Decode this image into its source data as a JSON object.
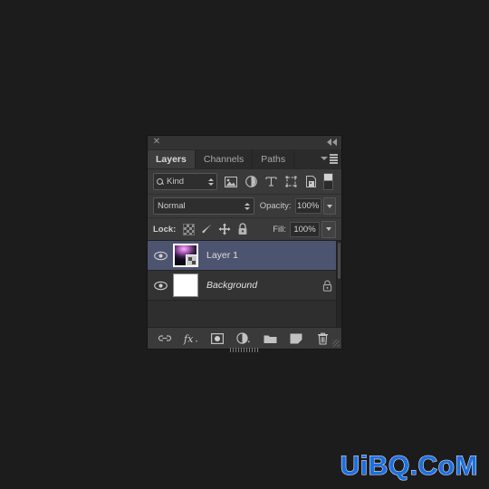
{
  "app": {
    "background_color": "#1d1c1c",
    "accent_selected_row": "#4d5470",
    "panel_background": "#3a3a3a"
  },
  "panel": {
    "titlebar": {
      "close_label": "✕",
      "close_icon": "close-icon",
      "collapse_icon": "collapse-double-chevron-icon"
    },
    "tabs": [
      {
        "label": "Layers",
        "active": true
      },
      {
        "label": "Channels",
        "active": false
      },
      {
        "label": "Paths",
        "active": false
      }
    ],
    "menu_icon": "panel-menu-icon",
    "filter_row": {
      "kind_label": "Kind",
      "search_icon": "search-icon",
      "stepper_icon": "up-down-stepper-icon",
      "filters": [
        {
          "name": "filter-pixel-layers-icon",
          "title": "Pixel layers"
        },
        {
          "name": "filter-adjustment-layers-icon",
          "title": "Adjustment layers"
        },
        {
          "name": "filter-type-layers-icon",
          "title": "Type layers"
        },
        {
          "name": "filter-shape-layers-icon",
          "title": "Shape layers"
        },
        {
          "name": "filter-smart-object-layers-icon",
          "title": "Smart object layers"
        }
      ],
      "toggle_icon": "filter-enable-toggle-icon"
    },
    "blend_row": {
      "blend_mode": "Normal",
      "opacity_label": "Opacity:",
      "opacity_value": "100%"
    },
    "lock_row": {
      "lock_label": "Lock:",
      "lock_icons": [
        {
          "name": "lock-transparent-pixels-icon"
        },
        {
          "name": "lock-image-pixels-icon"
        },
        {
          "name": "lock-position-icon"
        },
        {
          "name": "lock-all-icon"
        }
      ],
      "fill_label": "Fill:",
      "fill_value": "100%"
    },
    "layers": [
      {
        "name": "Layer 1",
        "selected": true,
        "italic": false,
        "visible": true,
        "thumbnail": "purple-aurora-image",
        "has_smart_object_badge": true,
        "locked": false
      },
      {
        "name": "Background",
        "selected": false,
        "italic": true,
        "visible": true,
        "thumbnail": "white-fill",
        "has_smart_object_badge": false,
        "locked": true
      }
    ],
    "bottom_bar": [
      {
        "name": "link-layers-icon",
        "title": "Link layers"
      },
      {
        "name": "layer-style-fx-icon",
        "title": "Add a layer style",
        "label": "fx"
      },
      {
        "name": "add-layer-mask-icon",
        "title": "Add layer mask"
      },
      {
        "name": "new-adjustment-layer-icon",
        "title": "New fill or adjustment layer"
      },
      {
        "name": "new-group-icon",
        "title": "Create a new group"
      },
      {
        "name": "new-layer-icon",
        "title": "Create a new layer"
      },
      {
        "name": "delete-layer-icon",
        "title": "Delete layer"
      }
    ]
  },
  "watermark": {
    "text": "UiBQ.CoM",
    "color": "#1d6fe0"
  }
}
